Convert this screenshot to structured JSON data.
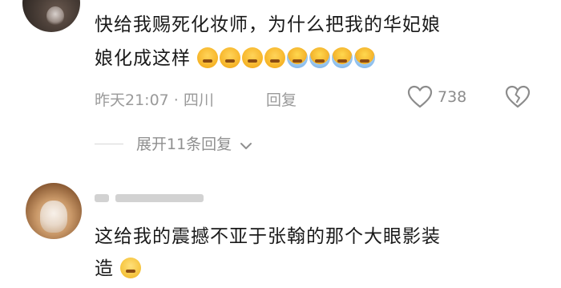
{
  "comments": [
    {
      "text_line1": "快给我赐死化妆师，为什么把我的华妃娘",
      "text_line2": "娘化成这样",
      "emojis": [
        "crying-face-emoji",
        "crying-face-emoji",
        "crying-face-emoji",
        "crying-face-emoji",
        "sobbing-face-emoji",
        "sobbing-face-emoji",
        "sobbing-face-emoji",
        "sobbing-face-emoji"
      ],
      "time_location": "昨天21:07 · 四川",
      "reply_label": "回复",
      "like_count": "738",
      "expand_replies_label": "展开11条回复"
    },
    {
      "text_line1": "这给我的震撼不亚于张翰的那个大眼影装",
      "text_line2": "造",
      "emojis": [
        "pleading-face-emoji"
      ]
    }
  ],
  "colors": {
    "text": "#1a1a1a",
    "meta": "#9a9a9a"
  }
}
